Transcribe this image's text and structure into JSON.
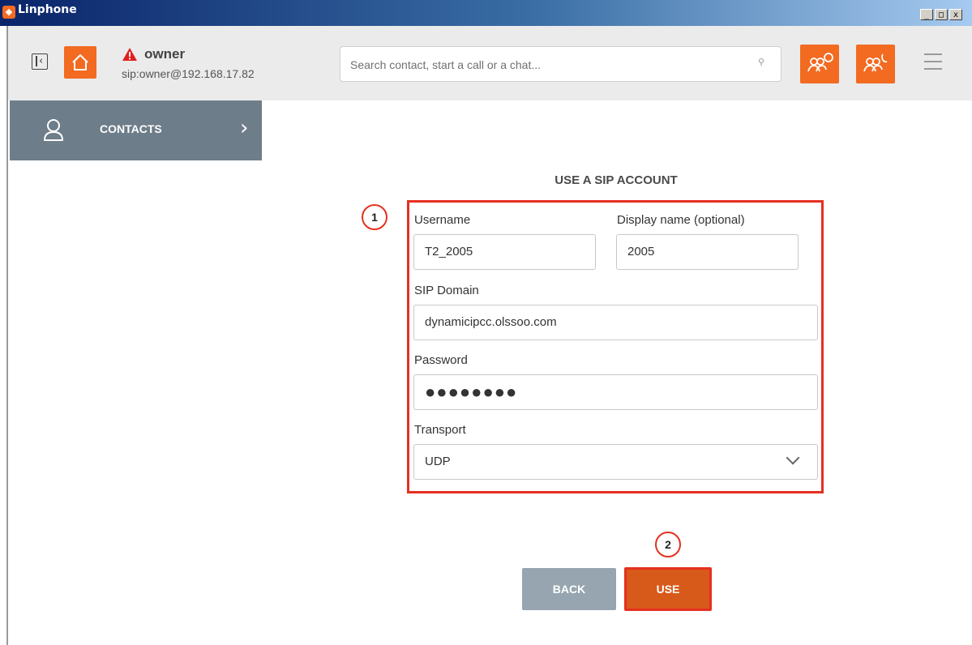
{
  "window": {
    "title": "Linphone",
    "controls": [
      "_",
      "□",
      "x"
    ]
  },
  "header": {
    "user_name": "owner",
    "user_sip": "sip:owner@192.168.17.82",
    "search_placeholder": "Search contact, start a call or a chat...",
    "accent": "#f26b21"
  },
  "sidebar": {
    "contacts_label": "CONTACTS"
  },
  "form": {
    "title": "USE A SIP ACCOUNT",
    "annotation_1": "1",
    "annotation_2": "2",
    "username_label": "Username",
    "username_value": "T2_2005",
    "display_name_label": "Display name (optional)",
    "display_name_value": "2005",
    "domain_label": "SIP Domain",
    "domain_value": "dynamicipcc.olssoo.com",
    "password_label": "Password",
    "password_value": "●●●●●●●●",
    "transport_label": "Transport",
    "transport_value": "UDP",
    "back_label": "BACK",
    "use_label": "USE"
  }
}
